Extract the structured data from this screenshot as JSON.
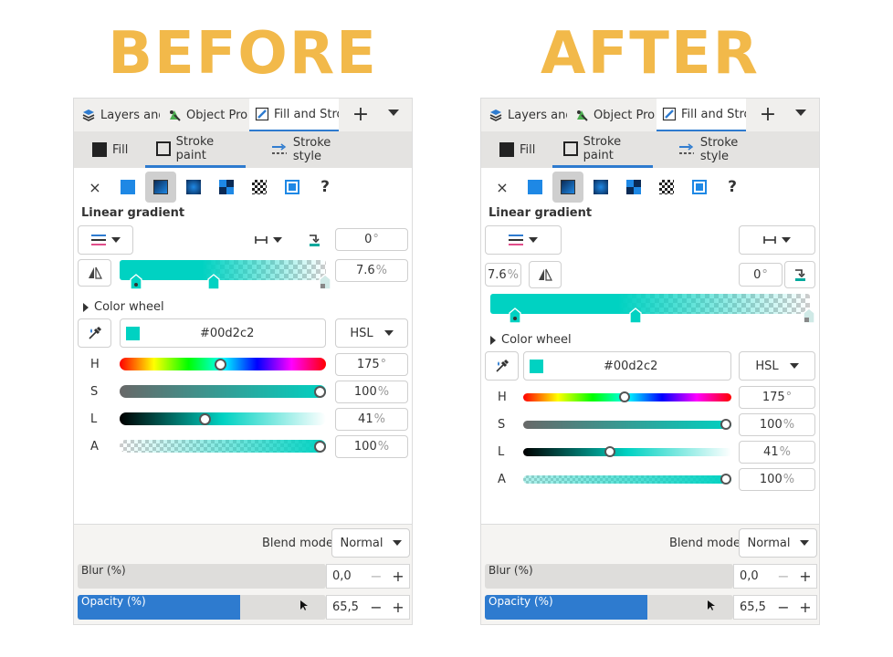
{
  "headings": {
    "before": "BEFORE",
    "after": "AFTER"
  },
  "colors": {
    "accent": "#2e7bcf",
    "heading": "#f2b94a",
    "swatch": "#00d2c2"
  },
  "panel": {
    "tabs": [
      {
        "label": "Layers and Objects",
        "icon": "layers-icon"
      },
      {
        "label": "Object Properties",
        "icon": "object-properties-icon"
      },
      {
        "label": "Fill and Stroke",
        "icon": "fill-stroke-icon"
      }
    ],
    "add_tab": "+",
    "subtabs": {
      "fill": "Fill",
      "stroke_paint": "Stroke paint",
      "stroke_style": "Stroke style"
    },
    "paint_types": [
      {
        "icon": "no-paint-icon",
        "glyph": "×"
      },
      {
        "icon": "flat-color-icon"
      },
      {
        "icon": "linear-gradient-icon"
      },
      {
        "icon": "radial-gradient-icon"
      },
      {
        "icon": "mesh-gradient-icon"
      },
      {
        "icon": "pattern-icon"
      },
      {
        "icon": "swatch-icon"
      },
      {
        "icon": "unset-paint-icon",
        "glyph": "?"
      }
    ],
    "gradient_label": "Linear gradient",
    "angle": "0",
    "offset": "7.6",
    "degree_sign": "°",
    "percent_sign": "%",
    "color_wheel_label": "Color wheel",
    "hex": "#00d2c2",
    "color_mode": "HSL",
    "sliders": [
      {
        "label": "H",
        "value": "175",
        "unit": "°",
        "fraction": 0.486
      },
      {
        "label": "S",
        "value": "100",
        "unit": "%",
        "fraction": 1.0
      },
      {
        "label": "L",
        "value": "41",
        "unit": "%",
        "fraction": 0.41
      },
      {
        "label": "A",
        "value": "100",
        "unit": "%",
        "fraction": 1.0
      }
    ],
    "blend_mode_label": "Blend mode",
    "blend_mode": "Normal",
    "blur_label": "Blur (%)",
    "blur_value": "0,0",
    "blur_fraction": 0.0,
    "opacity_label": "Opacity (%)",
    "opacity_value": "65,5",
    "opacity_fraction": 0.655,
    "plus": "+",
    "minus": "−"
  }
}
